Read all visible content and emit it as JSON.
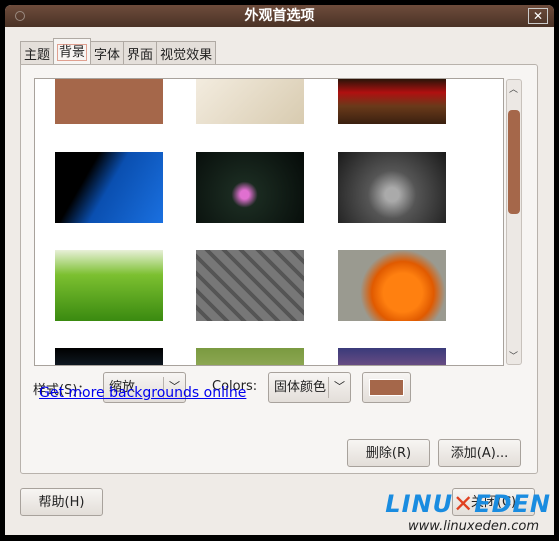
{
  "window": {
    "title": "外观首选项"
  },
  "tabs": [
    {
      "label": "主题"
    },
    {
      "label": "背景",
      "active": true
    },
    {
      "label": "字体"
    },
    {
      "label": "界面"
    },
    {
      "label": "视觉效果"
    }
  ],
  "gallery": {
    "thumbnails": [
      {
        "name": "solid-brown"
      },
      {
        "name": "butterfly"
      },
      {
        "name": "cherries"
      },
      {
        "name": "blue-silhouette"
      },
      {
        "name": "water-lily"
      },
      {
        "name": "hands-stones"
      },
      {
        "name": "green-grass"
      },
      {
        "name": "stone-wall-shoes"
      },
      {
        "name": "orange-flower"
      },
      {
        "name": "dark-water"
      },
      {
        "name": "green-leaf"
      },
      {
        "name": "purple-sky"
      }
    ]
  },
  "style": {
    "label": "样式(S)：",
    "value": "缩放"
  },
  "colors": {
    "label": "Colors:",
    "value": "固体颜色",
    "swatch": "#a5674a"
  },
  "link": "Get more backgrounds online",
  "buttons": {
    "remove": "删除(R)",
    "add": "添加(A)...",
    "help": "帮助(H)",
    "close": "关闭(C)"
  },
  "watermark": {
    "logo": "LINUXEDEN",
    "url": "www.linuxeden.com"
  }
}
